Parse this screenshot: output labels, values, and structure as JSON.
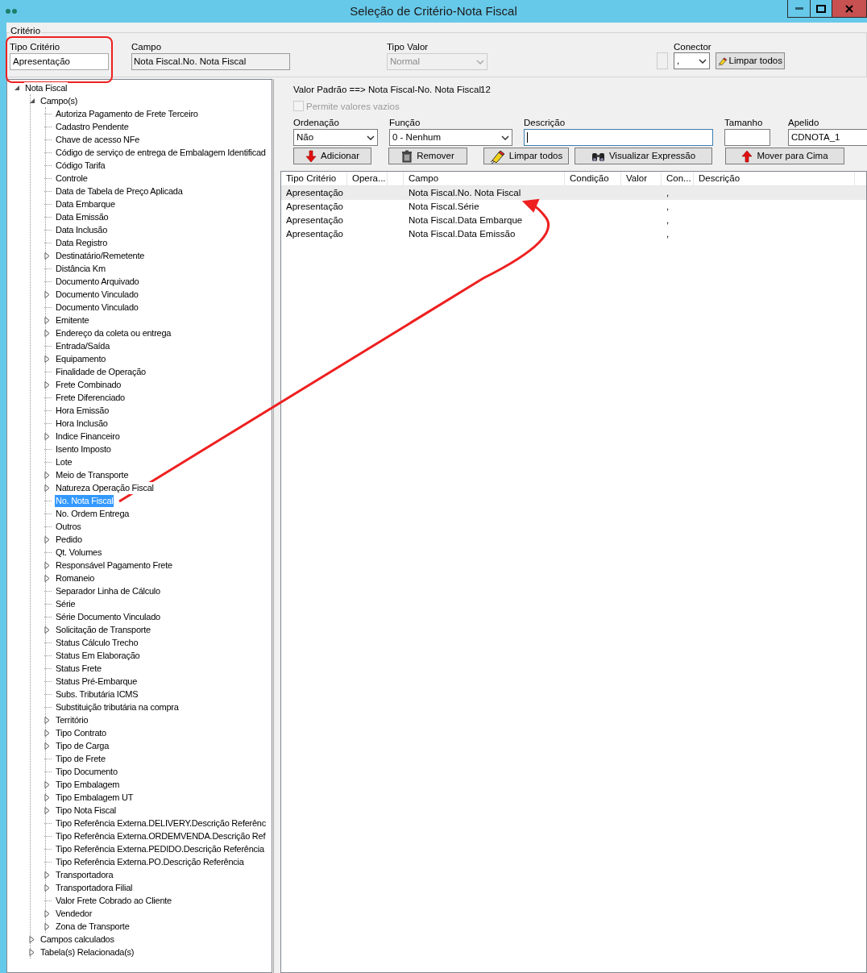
{
  "window": {
    "title": "Seleção de Critério-Nota Fiscal"
  },
  "criterio": {
    "label": "Critério",
    "tipo_criterio": {
      "label": "Tipo Critério",
      "value": "Apresentação"
    },
    "campo": {
      "label": "Campo",
      "value": "Nota Fiscal.No. Nota Fiscal"
    },
    "tipo_valor": {
      "label": "Tipo Valor",
      "value": "Normal",
      "disabled": true
    },
    "conector_checkbox": {
      "checked": false,
      "disabled": true
    },
    "conector": {
      "label": "Conector",
      "value": ","
    },
    "clear_button": "Limpar todos"
  },
  "tree": [
    {
      "label": "Nota Fiscal",
      "expanded": true,
      "selected": false,
      "children": [
        {
          "label": "Campo(s)",
          "expanded": true,
          "selected": false,
          "children": [
            {
              "label": "Autoriza Pagamento de Frete Terceiro",
              "selected": false
            },
            {
              "label": "Cadastro Pendente",
              "selected": false
            },
            {
              "label": "Chave de acesso NFe",
              "selected": false
            },
            {
              "label": "Código de serviço de entrega de Embalagem Identificad",
              "selected": false
            },
            {
              "label": "Código Tarifa",
              "selected": false
            },
            {
              "label": "Controle",
              "selected": false
            },
            {
              "label": "Data de Tabela de Preço Aplicada",
              "selected": false
            },
            {
              "label": "Data Embarque",
              "selected": false
            },
            {
              "label": "Data Emissão",
              "selected": false
            },
            {
              "label": "Data Inclusão",
              "selected": false
            },
            {
              "label": "Data Registro",
              "selected": false
            },
            {
              "label": "Destinatário/Remetente",
              "expanded": false,
              "selected": false
            },
            {
              "label": "Distância Km",
              "selected": false
            },
            {
              "label": "Documento Arquivado",
              "selected": false
            },
            {
              "label": "Documento Vinculado",
              "expanded": false,
              "selected": false
            },
            {
              "label": "Documento Vinculado",
              "selected": false
            },
            {
              "label": "Emitente",
              "expanded": false,
              "selected": false
            },
            {
              "label": "Endereço da coleta ou entrega",
              "expanded": false,
              "selected": false
            },
            {
              "label": "Entrada/Saída",
              "selected": false
            },
            {
              "label": "Equipamento",
              "expanded": false,
              "selected": false
            },
            {
              "label": "Finalidade de Operação",
              "selected": false
            },
            {
              "label": "Frete Combinado",
              "expanded": false,
              "selected": false
            },
            {
              "label": "Frete Diferenciado",
              "selected": false
            },
            {
              "label": "Hora Emissão",
              "selected": false
            },
            {
              "label": "Hora Inclusão",
              "selected": false
            },
            {
              "label": "Indice Financeiro",
              "expanded": false,
              "selected": false
            },
            {
              "label": "Isento Imposto",
              "selected": false
            },
            {
              "label": "Lote",
              "selected": false
            },
            {
              "label": "Meio de Transporte",
              "expanded": false,
              "selected": false
            },
            {
              "label": "Natureza Operação Fiscal",
              "expanded": false,
              "selected": false
            },
            {
              "label": "No. Nota Fiscal",
              "selected": true
            },
            {
              "label": "No. Ordem Entrega",
              "selected": false
            },
            {
              "label": "Outros",
              "selected": false
            },
            {
              "label": "Pedido",
              "expanded": false,
              "selected": false
            },
            {
              "label": "Qt. Volumes",
              "selected": false
            },
            {
              "label": "Responsável Pagamento Frete",
              "expanded": false,
              "selected": false
            },
            {
              "label": "Romaneio",
              "expanded": false,
              "selected": false
            },
            {
              "label": "Separador Linha de Cálculo",
              "selected": false
            },
            {
              "label": "Série",
              "selected": false
            },
            {
              "label": "Série Documento Vinculado",
              "selected": false
            },
            {
              "label": "Solicitação de Transporte",
              "expanded": false,
              "selected": false
            },
            {
              "label": "Status Cálculo Trecho",
              "selected": false
            },
            {
              "label": "Status Em Elaboração",
              "selected": false
            },
            {
              "label": "Status Frete",
              "selected": false
            },
            {
              "label": "Status Pré-Embarque",
              "selected": false
            },
            {
              "label": "Subs. Tributária ICMS",
              "selected": false
            },
            {
              "label": "Substituição tributária na compra",
              "selected": false
            },
            {
              "label": "Território",
              "expanded": false,
              "selected": false
            },
            {
              "label": "Tipo Contrato",
              "expanded": false,
              "selected": false
            },
            {
              "label": "Tipo de Carga",
              "expanded": false,
              "selected": false
            },
            {
              "label": "Tipo de Frete",
              "selected": false
            },
            {
              "label": "Tipo Documento",
              "selected": false
            },
            {
              "label": "Tipo Embalagem",
              "expanded": false,
              "selected": false
            },
            {
              "label": "Tipo Embalagem UT",
              "expanded": false,
              "selected": false
            },
            {
              "label": "Tipo Nota Fiscal",
              "expanded": false,
              "selected": false
            },
            {
              "label": "Tipo Referência Externa.DELIVERY.Descrição Referênc",
              "selected": false
            },
            {
              "label": "Tipo Referência Externa.ORDEMVENDA.Descrição Ref",
              "selected": false
            },
            {
              "label": "Tipo Referência Externa.PEDIDO.Descrição Referência",
              "selected": false
            },
            {
              "label": "Tipo Referência Externa.PO.Descrição Referência",
              "selected": false
            },
            {
              "label": "Transportadora",
              "expanded": false,
              "selected": false
            },
            {
              "label": "Transportadora Filial",
              "expanded": false,
              "selected": false
            },
            {
              "label": "Valor Frete Cobrado ao Cliente",
              "selected": false
            },
            {
              "label": "Vendedor",
              "expanded": false,
              "selected": false
            },
            {
              "label": "Zona de Transporte",
              "expanded": false,
              "selected": false
            }
          ]
        },
        {
          "label": "Campos calculados",
          "expanded": false,
          "selected": false
        },
        {
          "label": "Tabela(s) Relacionada(s)",
          "expanded": false,
          "selected": false
        }
      ]
    }
  ],
  "detail": {
    "valor_padrao": {
      "label": "Valor Padrão ==>",
      "value": "Nota Fiscal-No. Nota Fiscal",
      "size": "12"
    },
    "permite_vazios": {
      "label": "Permite valores vazios",
      "checked": false,
      "disabled": true
    },
    "ordenacao": {
      "label": "Ordenação",
      "value": "Não"
    },
    "funcao": {
      "label": "Função",
      "value": "0 - Nenhum"
    },
    "descricao": {
      "label": "Descrição",
      "focused": true
    },
    "tamanho": {
      "label": "Tamanho"
    },
    "apelido": {
      "label": "Apelido",
      "value": "CDNOTA_1"
    },
    "buttons": [
      {
        "kind": "add",
        "label": "Adicionar"
      },
      {
        "kind": "remove",
        "label": "Remover"
      },
      {
        "kind": "clear",
        "label": "Limpar todos"
      },
      {
        "kind": "view",
        "label": "Visualizar Expressão"
      },
      {
        "kind": "up",
        "label": "Mover para Cima"
      }
    ]
  },
  "grid": {
    "columns": [
      "Tipo Critério",
      "Opera...",
      "",
      "Campo",
      "Condição",
      "Valor",
      "Con...",
      "Descrição"
    ],
    "rows": [
      {
        "tipo_criterio": "Apresentação",
        "campo": "Nota Fiscal.No. Nota Fiscal",
        "conector": ",",
        "selected": true
      },
      {
        "tipo_criterio": "Apresentação",
        "campo": "Nota Fiscal.Série",
        "conector": ",",
        "selected": false
      },
      {
        "tipo_criterio": "Apresentação",
        "campo": "Nota Fiscal.Data Embarque",
        "conector": ",",
        "selected": false
      },
      {
        "tipo_criterio": "Apresentação",
        "campo": "Nota Fiscal.Data Emissão",
        "conector": ",",
        "selected": false
      }
    ]
  }
}
